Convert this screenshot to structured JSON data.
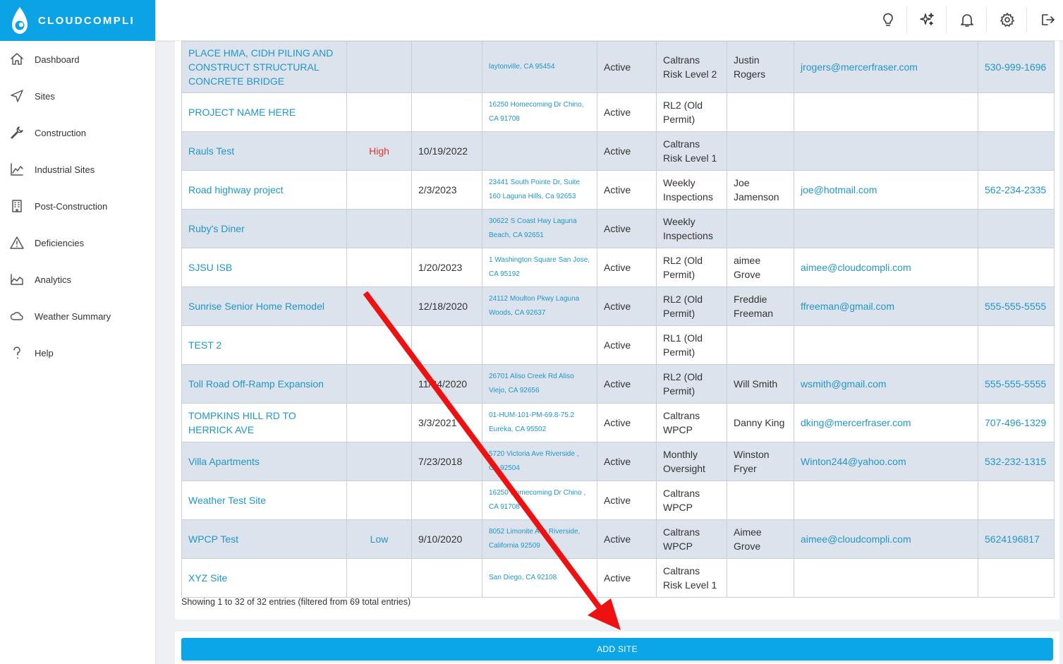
{
  "brand": {
    "name": "CLOUDCOMPLI",
    "color": "#0ba3e6"
  },
  "nav": [
    {
      "label": "Dashboard",
      "icon": "home-icon"
    },
    {
      "label": "Sites",
      "icon": "navigation-arrow-icon"
    },
    {
      "label": "Construction",
      "icon": "wrench-icon"
    },
    {
      "label": "Industrial Sites",
      "icon": "factory-chart-icon"
    },
    {
      "label": "Post-Construction",
      "icon": "building-icon"
    },
    {
      "label": "Deficiencies",
      "icon": "warning-triangle-icon"
    },
    {
      "label": "Analytics",
      "icon": "area-chart-icon"
    },
    {
      "label": "Weather Summary",
      "icon": "cloud-icon"
    },
    {
      "label": "Help",
      "icon": "question-icon"
    }
  ],
  "topbar_icons": [
    "lightbulb-icon",
    "sparkles-icon",
    "bell-icon",
    "gear-icon",
    "logout-icon"
  ],
  "table": {
    "rows": [
      {
        "name": "PLACE HMA, CIDH PILING AND CONSTRUCT STRUCTURAL CONCRETE BRIDGE",
        "risk": "",
        "date": "",
        "address": "laytonville, CA 95454",
        "status": "Active",
        "permit": "Caltrans Risk Level 2",
        "contact": "Justin Rogers",
        "email": "jrogers@mercerfraser.com",
        "phone": "530-999-1696"
      },
      {
        "name": "PROJECT NAME HERE",
        "risk": "",
        "date": "",
        "address": "16250 Homecoming Dr Chino, CA 91708",
        "status": "Active",
        "permit": "RL2 (Old Permit)",
        "contact": "",
        "email": "",
        "phone": ""
      },
      {
        "name": "Rauls Test",
        "risk": "High",
        "date": "10/19/2022",
        "address": "",
        "status": "Active",
        "permit": "Caltrans Risk Level 1",
        "contact": "",
        "email": "",
        "phone": ""
      },
      {
        "name": "Road highway project",
        "risk": "",
        "date": "2/3/2023",
        "address": "23441 South Pointe Dr, Suite 160 Laguna Hills, Ca 92653",
        "status": "Active",
        "permit": "Weekly Inspections",
        "contact": "Joe Jamenson",
        "email": "joe@hotmail.com",
        "phone": "562-234-2335"
      },
      {
        "name": "Ruby's Diner",
        "risk": "",
        "date": "",
        "address": "30622 S Coast Hwy Laguna Beach, CA 92651",
        "status": "Active",
        "permit": "Weekly Inspections",
        "contact": "",
        "email": "",
        "phone": ""
      },
      {
        "name": "SJSU ISB",
        "risk": "",
        "date": "1/20/2023",
        "address": "1 Washington Square San Jose, CA 95192",
        "status": "Active",
        "permit": "RL2 (Old Permit)",
        "contact": "aimee Grove",
        "email": "aimee@cloudcompli.com",
        "phone": ""
      },
      {
        "name": "Sunrise Senior Home Remodel",
        "risk": "",
        "date": "12/18/2020",
        "address": "24112 Moulton Pkwy Laguna Woods, CA 92637",
        "status": "Active",
        "permit": "RL2 (Old Permit)",
        "contact": "Freddie Freeman",
        "email": "ffreeman@gmail.com",
        "phone": "555-555-5555"
      },
      {
        "name": "TEST 2",
        "risk": "",
        "date": "",
        "address": "",
        "status": "Active",
        "permit": "RL1 (Old Permit)",
        "contact": "",
        "email": "",
        "phone": ""
      },
      {
        "name": "Toll Road Off-Ramp Expansion",
        "risk": "",
        "date": "11/24/2020",
        "address": "26701 Aliso Creek Rd Aliso Viejo, CA 92656",
        "status": "Active",
        "permit": "RL2 (Old Permit)",
        "contact": "Will Smith",
        "email": "wsmith@gmail.com",
        "phone": "555-555-5555"
      },
      {
        "name": "TOMPKINS HILL RD TO HERRICK AVE",
        "risk": "",
        "date": "3/3/2021",
        "address": "01-HUM-101-PM-69.8-75.2 Eureka, CA 95502",
        "status": "Active",
        "permit": "Caltrans WPCP",
        "contact": "Danny King",
        "email": "dking@mercerfraser.com",
        "phone": "707-496-1329"
      },
      {
        "name": "Villa Apartments",
        "risk": "",
        "date": "7/23/2018",
        "address": "5720 Victoria Ave Riverside , CA 92504",
        "status": "Active",
        "permit": "Monthly Oversight",
        "contact": "Winston Fryer",
        "email": "Winton244@yahoo.com",
        "phone": "532-232-1315"
      },
      {
        "name": "Weather Test Site",
        "risk": "",
        "date": "",
        "address": "16250 Homecoming Dr Chino , CA 91708",
        "status": "Active",
        "permit": "Caltrans WPCP",
        "contact": "",
        "email": "",
        "phone": ""
      },
      {
        "name": "WPCP Test",
        "risk": "Low",
        "date": "9/10/2020",
        "address": "8052 Limonite Ave Riverside, California 92509",
        "status": "Active",
        "permit": "Caltrans WPCP",
        "contact": "Aimee Grove",
        "email": "aimee@cloudcompli.com",
        "phone": "5624196817"
      },
      {
        "name": "XYZ Site",
        "risk": "",
        "date": "",
        "address": "San Diego, CA 92108",
        "status": "Active",
        "permit": "Caltrans Risk Level 1",
        "contact": "",
        "email": "",
        "phone": ""
      }
    ],
    "footnote": "Showing 1 to 32 of 32 entries (filtered from 69 total entries)"
  },
  "add_site_label": "ADD SITE",
  "colors": {
    "accent": "#0aa6e8",
    "link": "#2196c9",
    "risk_high": "#e5332a",
    "row_alt": "#dde3ec",
    "annotation_arrow": "#ee1111"
  }
}
